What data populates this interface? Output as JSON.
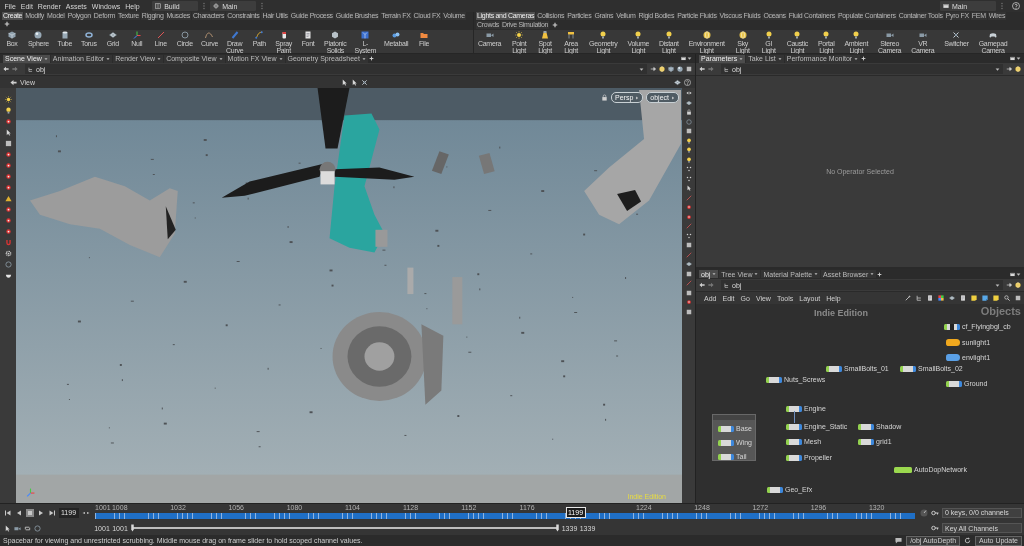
{
  "menu_bar": {
    "menus": [
      "File",
      "Edit",
      "Render",
      "Assets",
      "Windows",
      "Help"
    ],
    "desktop": "Build",
    "desktop_context": "Main",
    "right_desktop": "Main"
  },
  "shelf_sets": [
    {
      "tabs": [
        {
          "label": "Create",
          "selected": true
        },
        {
          "label": "Modify",
          "selected": false
        },
        {
          "label": "Model",
          "selected": false
        },
        {
          "label": "Polygon",
          "selected": false
        },
        {
          "label": "Deform",
          "selected": false
        },
        {
          "label": "Texture",
          "selected": false
        },
        {
          "label": "Rigging",
          "selected": false
        },
        {
          "label": "Muscles",
          "selected": false
        },
        {
          "label": "Characters",
          "selected": false
        },
        {
          "label": "Constraints",
          "selected": false
        },
        {
          "label": "Hair Utils",
          "selected": false
        },
        {
          "label": "Guide Process",
          "selected": false
        },
        {
          "label": "Guide Brushes",
          "selected": false
        },
        {
          "label": "Terrain FX",
          "selected": false
        },
        {
          "label": "Cloud FX",
          "selected": false
        },
        {
          "label": "Volume",
          "selected": false
        }
      ],
      "tools": [
        "Box",
        "Sphere",
        "Tube",
        "Torus",
        "Grid",
        "Null",
        "Line",
        "Circle",
        "Curve",
        "Draw Curve",
        "Path",
        "Spray Paint",
        "Font",
        "Platonic Solids",
        "L-System",
        "Metaball",
        "File"
      ]
    },
    {
      "tabs": [
        {
          "label": "Lights and Cameras",
          "selected": true
        },
        {
          "label": "Collisions",
          "selected": false
        },
        {
          "label": "Particles",
          "selected": false
        },
        {
          "label": "Grains",
          "selected": false
        },
        {
          "label": "Vellum",
          "selected": false
        },
        {
          "label": "Rigid Bodies",
          "selected": false
        },
        {
          "label": "Particle Fluids",
          "selected": false
        },
        {
          "label": "Viscous Fluids",
          "selected": false
        },
        {
          "label": "Oceans",
          "selected": false
        },
        {
          "label": "Fluid Containers",
          "selected": false
        },
        {
          "label": "Populate Containers",
          "selected": false
        },
        {
          "label": "Container Tools",
          "selected": false
        },
        {
          "label": "Pyro FX",
          "selected": false
        },
        {
          "label": "FEM",
          "selected": false
        },
        {
          "label": "Wires",
          "selected": false
        },
        {
          "label": "Crowds",
          "selected": false
        },
        {
          "label": "Drive Simulation",
          "selected": false
        }
      ],
      "tools": [
        "Camera",
        "Point Light",
        "Spot Light",
        "Area Light",
        "Geometry Light",
        "Volume Light",
        "Distant Light",
        "Environment Light",
        "Sky Light",
        "GI Light",
        "Caustic Light",
        "Portal Light",
        "Ambient Light",
        "Stereo Camera",
        "VR Camera",
        "Switcher",
        "Gamepad Camera"
      ]
    }
  ],
  "scene_pane": {
    "tabs": [
      {
        "label": "Scene View",
        "selected": true
      },
      {
        "label": "Animation Editor",
        "selected": false
      },
      {
        "label": "Render View",
        "selected": false
      },
      {
        "label": "Composite View",
        "selected": false
      },
      {
        "label": "Motion FX View",
        "selected": false
      },
      {
        "label": "Geometry Spreadsheet",
        "selected": false
      }
    ],
    "path": "obj",
    "view_label": "View",
    "camera_menu": "Persp",
    "display_menu": "object",
    "edition": "Indie Edition"
  },
  "parameter_pane": {
    "tabs": [
      {
        "label": "Parameters",
        "selected": true
      },
      {
        "label": "Take List",
        "selected": false
      },
      {
        "label": "Performance Monitor",
        "selected": false
      }
    ],
    "path": "obj",
    "message": "No Operator Selected"
  },
  "network_pane": {
    "tabs": [
      {
        "label": "obj",
        "selected": true
      },
      {
        "label": "Tree View",
        "selected": false
      },
      {
        "label": "Material Palette",
        "selected": false
      },
      {
        "label": "Asset Browser",
        "selected": false
      }
    ],
    "path": "obj",
    "menus": [
      "Add",
      "Edit",
      "Go",
      "View",
      "Tools",
      "Layout",
      "Help"
    ],
    "edition": "Indie Edition",
    "context_label": "Objects",
    "nodes": [
      {
        "kind": "camera",
        "name": "cf_Flyingbgl_cb",
        "wired": false
      },
      {
        "kind": "light",
        "name": "sunlight1",
        "color": "#f0a81e",
        "wired": false
      },
      {
        "kind": "light",
        "name": "envlight1",
        "color": "#5aa0e6",
        "wired": false
      },
      {
        "kind": "geometry",
        "name": "SmallBolts_01",
        "wired": false
      },
      {
        "kind": "geometry",
        "name": "SmallBolts_02",
        "wired": false
      },
      {
        "kind": "geometry",
        "name": "Nuts_Screws",
        "wired": false
      },
      {
        "kind": "geometry",
        "name": "Ground",
        "wired": false
      },
      {
        "kind": "geometry",
        "name": "Engine",
        "wired": false
      },
      {
        "kind": "box",
        "children": [
          {
            "kind": "geometry",
            "name": "Base",
            "wired": false
          },
          {
            "kind": "geometry",
            "name": "Wing",
            "wired": false
          },
          {
            "kind": "geometry",
            "name": "Tail",
            "wired": false
          }
        ]
      },
      {
        "kind": "geometry",
        "name": "Engine_Static",
        "wired": true
      },
      {
        "kind": "geometry",
        "name": "Shadow",
        "wired": false
      },
      {
        "kind": "geometry",
        "name": "Mesh",
        "wired": false
      },
      {
        "kind": "geometry",
        "name": "grid1",
        "wired": false
      },
      {
        "kind": "geometry",
        "name": "Propeller",
        "wired": false
      },
      {
        "kind": "dop",
        "name": "AutoDopNetwork",
        "wired": false
      },
      {
        "kind": "geometry",
        "name": "Geo_Efx",
        "wired": false
      }
    ]
  },
  "timeline": {
    "playing": false,
    "frame": "1199",
    "start": "1001",
    "end": "1339",
    "ticks": [
      "1001",
      "1008",
      "1032",
      "1056",
      "1080",
      "1104",
      "1128",
      "1152",
      "1176",
      "1224",
      "1248",
      "1272",
      "1296",
      "1320"
    ],
    "marker": "1199",
    "level": 0.586,
    "range_start": "1001",
    "range_end": "1339",
    "keys_menu": "0 keys, 0/0 channels",
    "key_menu": "Key All Channels"
  },
  "status_bar": {
    "message": "Spacebar for viewing and unrestricted scrubbing. Middle mouse drag on frame slider to hold scoped channel values.",
    "path": "/obj AutoDepth",
    "update_mode": "Auto Update"
  }
}
